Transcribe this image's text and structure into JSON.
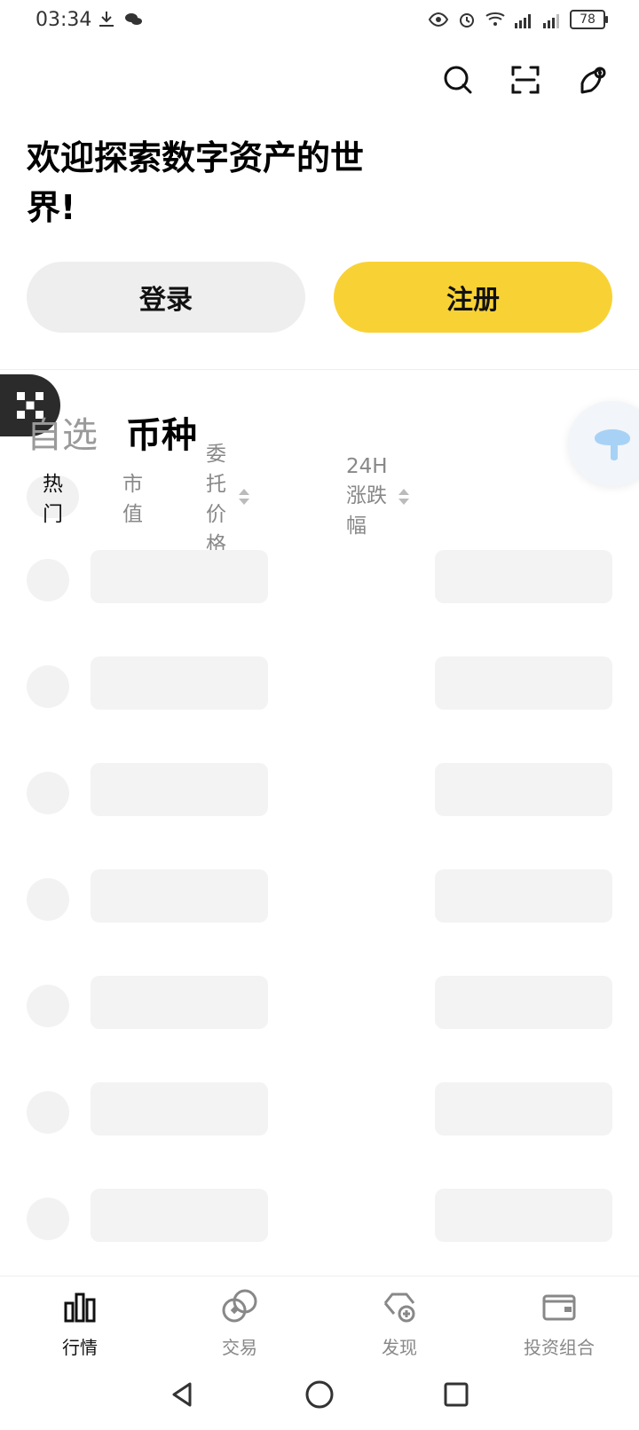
{
  "status": {
    "time": "03:34",
    "battery": "78"
  },
  "welcome": {
    "title": "欢迎探索数字资产的世界!"
  },
  "buttons": {
    "login": "登录",
    "register": "注册"
  },
  "tabs": {
    "watchlist": "自选",
    "coins": "币种"
  },
  "filters": {
    "hot": "热门",
    "market_cap": "市值",
    "order_price": "委托价格",
    "change_24h": "24H 涨跌幅"
  },
  "bottom_nav": {
    "market": "行情",
    "trade": "交易",
    "discover": "发现",
    "portfolio": "投资组合"
  },
  "icons": {
    "search": "search-icon",
    "scan": "scan-icon",
    "support": "support-icon"
  }
}
